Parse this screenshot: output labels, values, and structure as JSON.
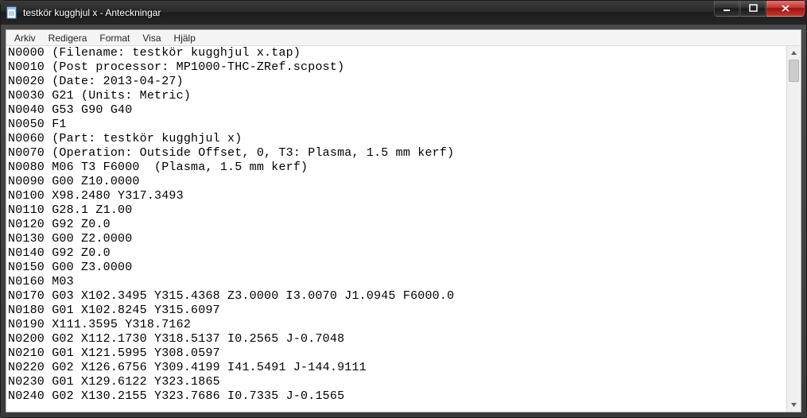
{
  "window": {
    "title": "testkör kugghjul x - Anteckningar"
  },
  "menu": {
    "items": [
      "Arkiv",
      "Redigera",
      "Format",
      "Visa",
      "Hjälp"
    ]
  },
  "editor": {
    "lines": [
      "N0000 (Filename: testkör kugghjul x.tap)",
      "N0010 (Post processor: MP1000-THC-ZRef.scpost)",
      "N0020 (Date: 2013-04-27)",
      "N0030 G21 (Units: Metric)",
      "N0040 G53 G90 G40",
      "N0050 F1",
      "N0060 (Part: testkör kugghjul x)",
      "N0070 (Operation: Outside Offset, 0, T3: Plasma, 1.5 mm kerf)",
      "N0080 M06 T3 F6000  (Plasma, 1.5 mm kerf)",
      "N0090 G00 Z10.0000",
      "N0100 X98.2480 Y317.3493",
      "N0110 G28.1 Z1.00",
      "N0120 G92 Z0.0",
      "N0130 G00 Z2.0000",
      "N0140 G92 Z0.0",
      "N0150 G00 Z3.0000",
      "N0160 M03",
      "N0170 G03 X102.3495 Y315.4368 Z3.0000 I3.0070 J1.0945 F6000.0",
      "N0180 G01 X102.8245 Y315.6097",
      "N0190 X111.3595 Y318.7162",
      "N0200 G02 X112.1730 Y318.5137 I0.2565 J-0.7048",
      "N0210 G01 X121.5995 Y308.0597",
      "N0220 G02 X126.6756 Y309.4199 I41.5491 J-144.9111",
      "N0230 G01 X129.6122 Y323.1865",
      "N0240 G02 X130.2155 Y323.7686 I0.7335 J-0.1565"
    ]
  }
}
